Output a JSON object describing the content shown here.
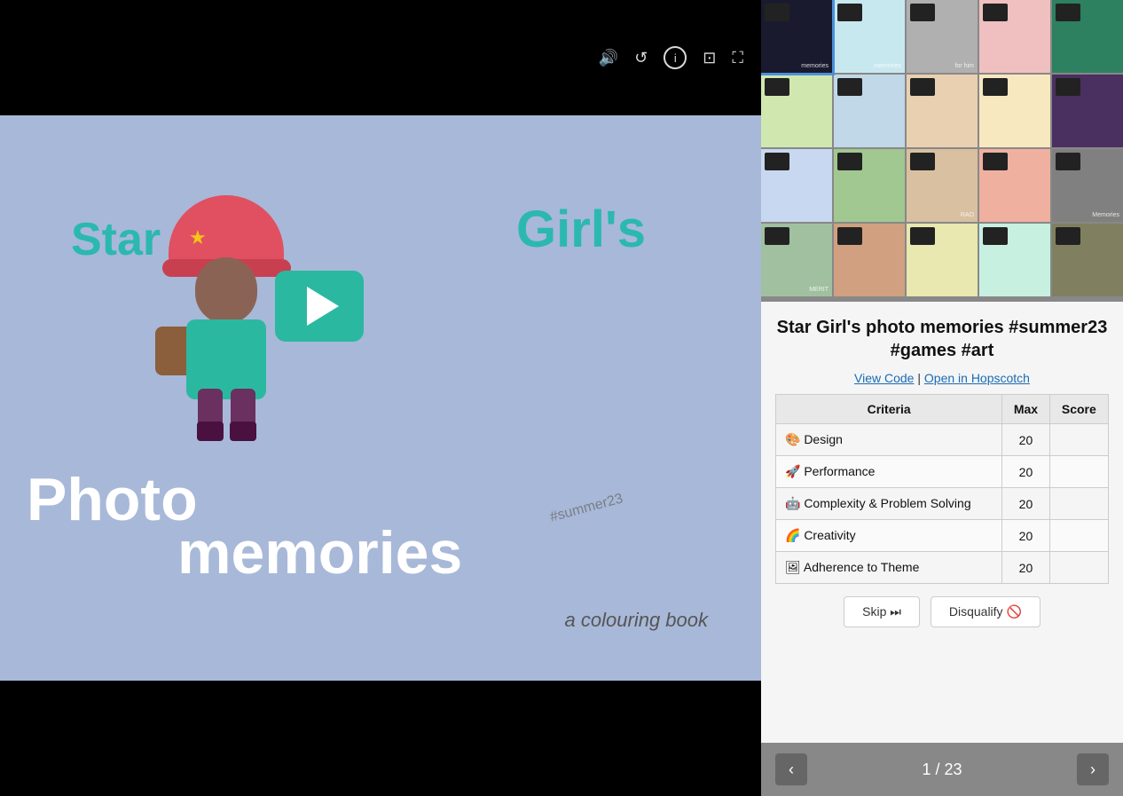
{
  "video": {
    "text_star": "Star",
    "text_girls": "Girl's",
    "text_photo": "Photo",
    "text_memories": "memories",
    "text_summer": "#summer23",
    "text_colouring": "a colouring book",
    "play_label": "▶"
  },
  "controls": {
    "volume_icon": "🔊",
    "reload_icon": "↺",
    "info_icon": "ⓘ",
    "screenshot_icon": "⊡",
    "fullscreen_icon": "⛶"
  },
  "project": {
    "title": "Star Girl's photo memories #summer23 #games #art",
    "link_view_code": "View Code",
    "link_separator": " | ",
    "link_open": "Open in Hopscotch"
  },
  "table": {
    "headers": [
      "Criteria",
      "Max",
      "Score"
    ],
    "rows": [
      {
        "icon": "🎨",
        "label": "Design",
        "max": 20,
        "score": ""
      },
      {
        "icon": "🚀",
        "label": "Performance",
        "max": 20,
        "score": ""
      },
      {
        "icon": "🤖",
        "label": "Complexity & Problem Solving",
        "max": 20,
        "score": ""
      },
      {
        "icon": "🌈",
        "label": "Creativity",
        "max": 20,
        "score": ""
      },
      {
        "icon": "🖼",
        "label": "Adherence to Theme",
        "max": 20,
        "score": ""
      }
    ]
  },
  "buttons": {
    "skip": "Skip ⏭",
    "disqualify": "Disqualify 🚫"
  },
  "pagination": {
    "current": 1,
    "total": 23,
    "display": "1 / 23",
    "prev": "‹",
    "next": "›"
  },
  "thumbnails": [
    {
      "id": 1,
      "selected": true
    },
    {
      "id": 2,
      "selected": false
    },
    {
      "id": 3,
      "selected": false
    },
    {
      "id": 4,
      "selected": false
    },
    {
      "id": 5,
      "selected": false
    },
    {
      "id": 6,
      "selected": false
    },
    {
      "id": 7,
      "selected": false
    },
    {
      "id": 8,
      "selected": false
    },
    {
      "id": 9,
      "selected": false
    },
    {
      "id": 10,
      "selected": false
    },
    {
      "id": 11,
      "selected": false
    },
    {
      "id": 12,
      "selected": false
    },
    {
      "id": 13,
      "selected": false
    },
    {
      "id": 14,
      "selected": false
    },
    {
      "id": 15,
      "selected": false
    },
    {
      "id": 16,
      "selected": false
    },
    {
      "id": 17,
      "selected": false
    },
    {
      "id": 18,
      "selected": false
    },
    {
      "id": 19,
      "selected": false
    },
    {
      "id": 20,
      "selected": false
    }
  ]
}
